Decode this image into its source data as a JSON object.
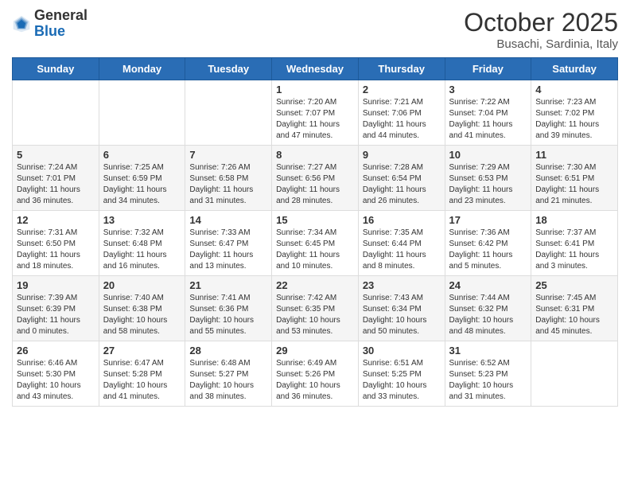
{
  "header": {
    "logo_general": "General",
    "logo_blue": "Blue",
    "month_title": "October 2025",
    "location": "Busachi, Sardinia, Italy"
  },
  "days_of_week": [
    "Sunday",
    "Monday",
    "Tuesday",
    "Wednesday",
    "Thursday",
    "Friday",
    "Saturday"
  ],
  "weeks": [
    [
      {
        "day": "",
        "info": ""
      },
      {
        "day": "",
        "info": ""
      },
      {
        "day": "",
        "info": ""
      },
      {
        "day": "1",
        "info": "Sunrise: 7:20 AM\nSunset: 7:07 PM\nDaylight: 11 hours and 47 minutes."
      },
      {
        "day": "2",
        "info": "Sunrise: 7:21 AM\nSunset: 7:06 PM\nDaylight: 11 hours and 44 minutes."
      },
      {
        "day": "3",
        "info": "Sunrise: 7:22 AM\nSunset: 7:04 PM\nDaylight: 11 hours and 41 minutes."
      },
      {
        "day": "4",
        "info": "Sunrise: 7:23 AM\nSunset: 7:02 PM\nDaylight: 11 hours and 39 minutes."
      }
    ],
    [
      {
        "day": "5",
        "info": "Sunrise: 7:24 AM\nSunset: 7:01 PM\nDaylight: 11 hours and 36 minutes."
      },
      {
        "day": "6",
        "info": "Sunrise: 7:25 AM\nSunset: 6:59 PM\nDaylight: 11 hours and 34 minutes."
      },
      {
        "day": "7",
        "info": "Sunrise: 7:26 AM\nSunset: 6:58 PM\nDaylight: 11 hours and 31 minutes."
      },
      {
        "day": "8",
        "info": "Sunrise: 7:27 AM\nSunset: 6:56 PM\nDaylight: 11 hours and 28 minutes."
      },
      {
        "day": "9",
        "info": "Sunrise: 7:28 AM\nSunset: 6:54 PM\nDaylight: 11 hours and 26 minutes."
      },
      {
        "day": "10",
        "info": "Sunrise: 7:29 AM\nSunset: 6:53 PM\nDaylight: 11 hours and 23 minutes."
      },
      {
        "day": "11",
        "info": "Sunrise: 7:30 AM\nSunset: 6:51 PM\nDaylight: 11 hours and 21 minutes."
      }
    ],
    [
      {
        "day": "12",
        "info": "Sunrise: 7:31 AM\nSunset: 6:50 PM\nDaylight: 11 hours and 18 minutes."
      },
      {
        "day": "13",
        "info": "Sunrise: 7:32 AM\nSunset: 6:48 PM\nDaylight: 11 hours and 16 minutes."
      },
      {
        "day": "14",
        "info": "Sunrise: 7:33 AM\nSunset: 6:47 PM\nDaylight: 11 hours and 13 minutes."
      },
      {
        "day": "15",
        "info": "Sunrise: 7:34 AM\nSunset: 6:45 PM\nDaylight: 11 hours and 10 minutes."
      },
      {
        "day": "16",
        "info": "Sunrise: 7:35 AM\nSunset: 6:44 PM\nDaylight: 11 hours and 8 minutes."
      },
      {
        "day": "17",
        "info": "Sunrise: 7:36 AM\nSunset: 6:42 PM\nDaylight: 11 hours and 5 minutes."
      },
      {
        "day": "18",
        "info": "Sunrise: 7:37 AM\nSunset: 6:41 PM\nDaylight: 11 hours and 3 minutes."
      }
    ],
    [
      {
        "day": "19",
        "info": "Sunrise: 7:39 AM\nSunset: 6:39 PM\nDaylight: 11 hours and 0 minutes."
      },
      {
        "day": "20",
        "info": "Sunrise: 7:40 AM\nSunset: 6:38 PM\nDaylight: 10 hours and 58 minutes."
      },
      {
        "day": "21",
        "info": "Sunrise: 7:41 AM\nSunset: 6:36 PM\nDaylight: 10 hours and 55 minutes."
      },
      {
        "day": "22",
        "info": "Sunrise: 7:42 AM\nSunset: 6:35 PM\nDaylight: 10 hours and 53 minutes."
      },
      {
        "day": "23",
        "info": "Sunrise: 7:43 AM\nSunset: 6:34 PM\nDaylight: 10 hours and 50 minutes."
      },
      {
        "day": "24",
        "info": "Sunrise: 7:44 AM\nSunset: 6:32 PM\nDaylight: 10 hours and 48 minutes."
      },
      {
        "day": "25",
        "info": "Sunrise: 7:45 AM\nSunset: 6:31 PM\nDaylight: 10 hours and 45 minutes."
      }
    ],
    [
      {
        "day": "26",
        "info": "Sunrise: 6:46 AM\nSunset: 5:30 PM\nDaylight: 10 hours and 43 minutes."
      },
      {
        "day": "27",
        "info": "Sunrise: 6:47 AM\nSunset: 5:28 PM\nDaylight: 10 hours and 41 minutes."
      },
      {
        "day": "28",
        "info": "Sunrise: 6:48 AM\nSunset: 5:27 PM\nDaylight: 10 hours and 38 minutes."
      },
      {
        "day": "29",
        "info": "Sunrise: 6:49 AM\nSunset: 5:26 PM\nDaylight: 10 hours and 36 minutes."
      },
      {
        "day": "30",
        "info": "Sunrise: 6:51 AM\nSunset: 5:25 PM\nDaylight: 10 hours and 33 minutes."
      },
      {
        "day": "31",
        "info": "Sunrise: 6:52 AM\nSunset: 5:23 PM\nDaylight: 10 hours and 31 minutes."
      },
      {
        "day": "",
        "info": ""
      }
    ]
  ]
}
